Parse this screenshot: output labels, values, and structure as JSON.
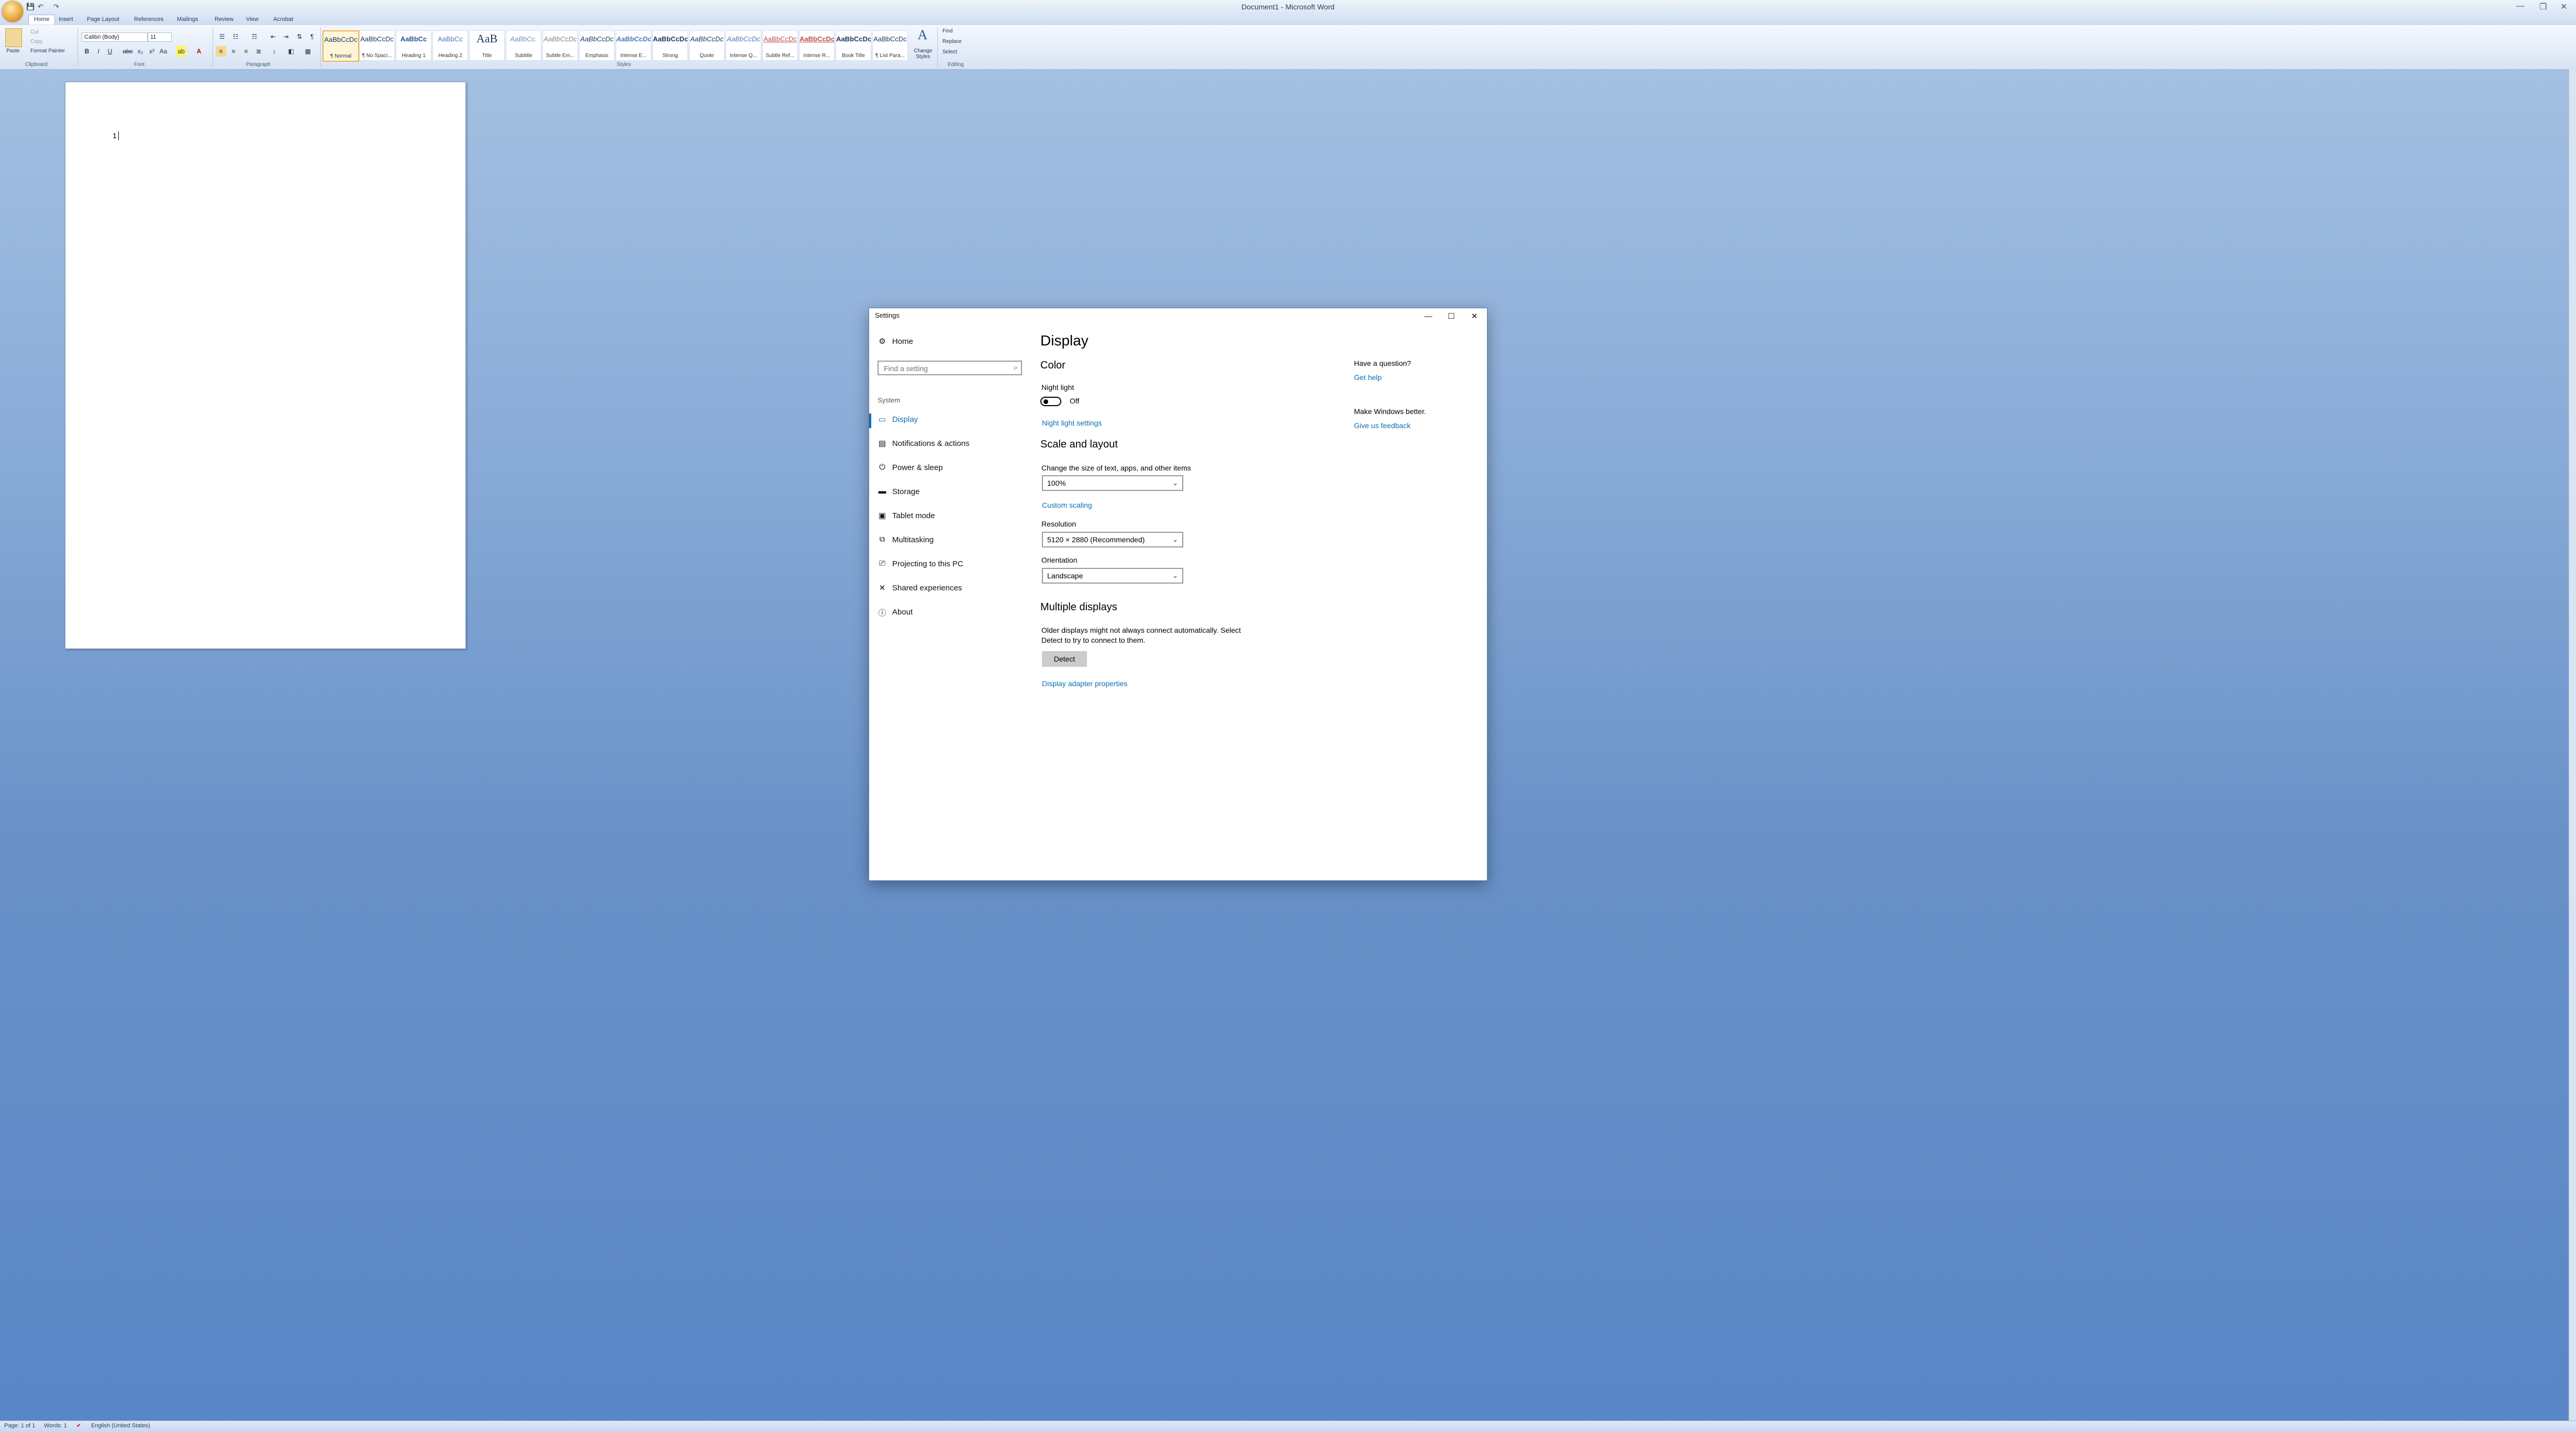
{
  "word": {
    "title": "Document1 - Microsoft Word",
    "qat": [
      "💾",
      "↶",
      "↷"
    ],
    "window_controls": [
      "—",
      "❐",
      "✕"
    ],
    "tabs": [
      "Home",
      "Insert",
      "Page Layout",
      "References",
      "Mailings",
      "Review",
      "View",
      "Acrobat"
    ],
    "clipboard": {
      "paste": "Paste",
      "cut": "Cut",
      "copy": "Copy",
      "format_painter": "Format Painter",
      "label": "Clipboard"
    },
    "font": {
      "name": "Calibri (Body)",
      "size": "11",
      "label": "Font",
      "buttons": [
        "B",
        "I",
        "U",
        "abc",
        "x₂",
        "x²",
        "Aa",
        "ab",
        "A"
      ]
    },
    "paragraph": {
      "label": "Paragraph"
    },
    "styles": {
      "label": "Styles",
      "items": [
        {
          "sample": "AaBbCcDc",
          "name": "¶ Normal"
        },
        {
          "sample": "AaBbCcDc",
          "name": "¶ No Spaci..."
        },
        {
          "sample": "AaBbCc",
          "name": "Heading 1"
        },
        {
          "sample": "AaBbCc",
          "name": "Heading 2"
        },
        {
          "sample": "AaB",
          "name": "Title"
        },
        {
          "sample": "AaBbCc.",
          "name": "Subtitle"
        },
        {
          "sample": "AaBbCcDc",
          "name": "Subtle Em..."
        },
        {
          "sample": "AaBbCcDc",
          "name": "Emphasis"
        },
        {
          "sample": "AaBbCcDc",
          "name": "Intense E..."
        },
        {
          "sample": "AaBbCcDc",
          "name": "Strong"
        },
        {
          "sample": "AaBbCcDc",
          "name": "Quote"
        },
        {
          "sample": "AaBbCcDc",
          "name": "Intense Q..."
        },
        {
          "sample": "AaBbCcDc",
          "name": "Subtle Ref..."
        },
        {
          "sample": "AaBbCcDc",
          "name": "Intense R..."
        },
        {
          "sample": "AaBbCcDc",
          "name": "Book Title"
        },
        {
          "sample": "AaBbCcDc",
          "name": "¶ List Para..."
        }
      ],
      "change_styles": "Change Styles"
    },
    "editing": {
      "label": "Editing",
      "find": "Find",
      "replace": "Replace",
      "select": "Select"
    },
    "document_text": "1",
    "status": {
      "page": "Page: 1 of 1",
      "words": "Words: 1",
      "language": "English (United States)"
    }
  },
  "settings": {
    "window_title": "Settings",
    "window_controls": [
      "—",
      "☐",
      "✕"
    ],
    "nav": {
      "home": "Home",
      "search_placeholder": "Find a setting",
      "section": "System",
      "items": [
        {
          "icon": "▭",
          "label": "Display"
        },
        {
          "icon": "▤",
          "label": "Notifications & actions"
        },
        {
          "icon": "⏻",
          "label": "Power & sleep"
        },
        {
          "icon": "▬",
          "label": "Storage"
        },
        {
          "icon": "▣",
          "label": "Tablet mode"
        },
        {
          "icon": "⧉",
          "label": "Multitasking"
        },
        {
          "icon": "⎚",
          "label": "Projecting to this PC"
        },
        {
          "icon": "✕",
          "label": "Shared experiences"
        },
        {
          "icon": "ⓘ",
          "label": "About"
        }
      ]
    },
    "main": {
      "title": "Display",
      "color_heading": "Color",
      "night_light_label": "Night light",
      "night_light_state": "Off",
      "night_light_link": "Night light settings",
      "scale_heading": "Scale and layout",
      "scale_label": "Change the size of text, apps, and other items",
      "scale_value": "100%",
      "custom_scaling": "Custom scaling",
      "resolution_label": "Resolution",
      "resolution_value": "5120 × 2880 (Recommended)",
      "orientation_label": "Orientation",
      "orientation_value": "Landscape",
      "multiple_heading": "Multiple displays",
      "multiple_text_1": "Older displays might not always connect automatically. Select",
      "multiple_text_2": "Detect to try to connect to them.",
      "detect_button": "Detect",
      "adapter_link": "Display adapter properties"
    },
    "aside": {
      "question": "Have a question?",
      "get_help": "Get help",
      "better": "Make Windows better.",
      "feedback": "Give us feedback"
    }
  }
}
